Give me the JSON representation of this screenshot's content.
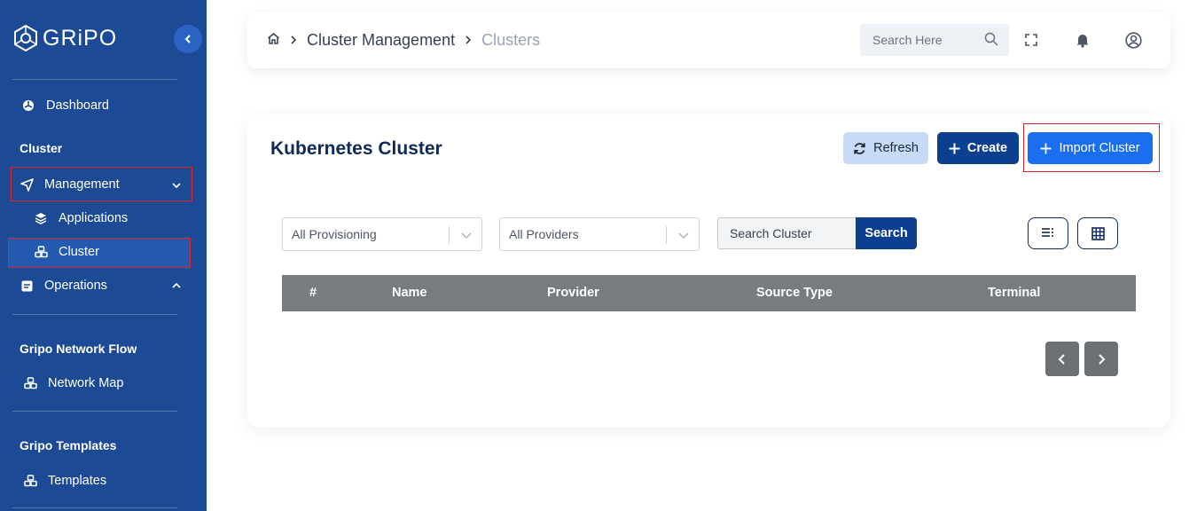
{
  "app": {
    "logo_text": "GRiPO"
  },
  "sidebar": {
    "dashboard": "Dashboard",
    "section_cluster": "Cluster",
    "management": "Management",
    "applications": "Applications",
    "cluster": "Cluster",
    "operations": "Operations",
    "section_network": "Gripo Network Flow",
    "network_map": "Network Map",
    "section_templates": "Gripo Templates",
    "templates": "Templates"
  },
  "header": {
    "breadcrumb_parent": "Cluster Management",
    "breadcrumb_current": "Clusters",
    "search_placeholder": "Search Here"
  },
  "main": {
    "title": "Kubernetes Cluster",
    "refresh_label": "Refresh",
    "create_label": "Create",
    "import_label": "Import Cluster",
    "filter_provisioning": "All Provisioning",
    "filter_providers": "All Providers",
    "search_placeholder": "Search Cluster",
    "search_button": "Search",
    "columns": [
      "#",
      "Name",
      "Provider",
      "Source Type",
      "Terminal"
    ]
  }
}
